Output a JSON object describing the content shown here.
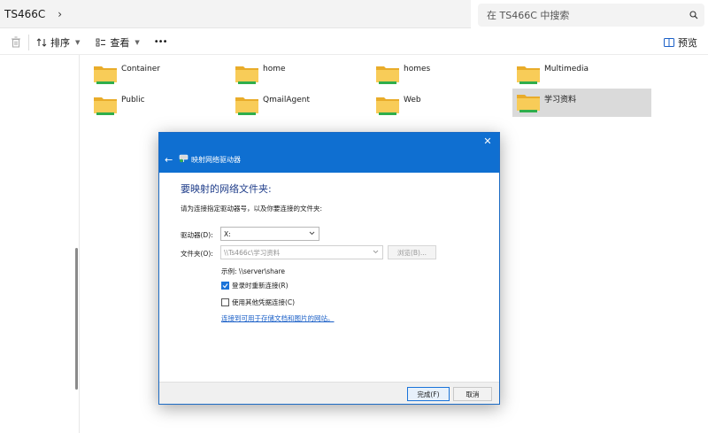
{
  "address_bar": {
    "path": "TS466C",
    "chevron": "›",
    "search_placeholder": "在 TS466C 中搜索",
    "search_icon": "search-icon"
  },
  "toolbar": {
    "delete_icon": "trash-icon",
    "sort_label": "排序",
    "view_label": "查看",
    "more_label": "•••",
    "preview_label": "预览"
  },
  "folders": [
    {
      "name": "Container"
    },
    {
      "name": "home"
    },
    {
      "name": "homes"
    },
    {
      "name": "Multimedia"
    },
    {
      "name": "Public"
    },
    {
      "name": "QmailAgent"
    },
    {
      "name": "Web"
    },
    {
      "name": "学习资料"
    }
  ],
  "dialog": {
    "title": "映射网络驱动器",
    "close": "✕",
    "back": "←",
    "heading": "要映射的网络文件夹:",
    "instruction": "请为连接指定驱动器号，以及你要连接的文件夹:",
    "drive_label": "驱动器(D):",
    "drive_value": "X:",
    "folder_label": "文件夹(O):",
    "folder_value": "\\\\Ts466c\\学习资料",
    "browse_button": "浏览(B)...",
    "example": "示例: \\\\server\\share",
    "reconnect_label": "登录时重新连接(R)",
    "reconnect_checked": true,
    "other_creds_label": "使用其他凭据连接(C)",
    "other_creds_checked": false,
    "link_text": "连接到可用于存储文档和图片的网站。",
    "finish_button": "完成(F)",
    "cancel_button": "取消"
  },
  "colors": {
    "dialog_header": "#0f6fd1",
    "folder_yellow": "#f5c543",
    "selection": "#dadada",
    "link": "#1a5fc7"
  }
}
